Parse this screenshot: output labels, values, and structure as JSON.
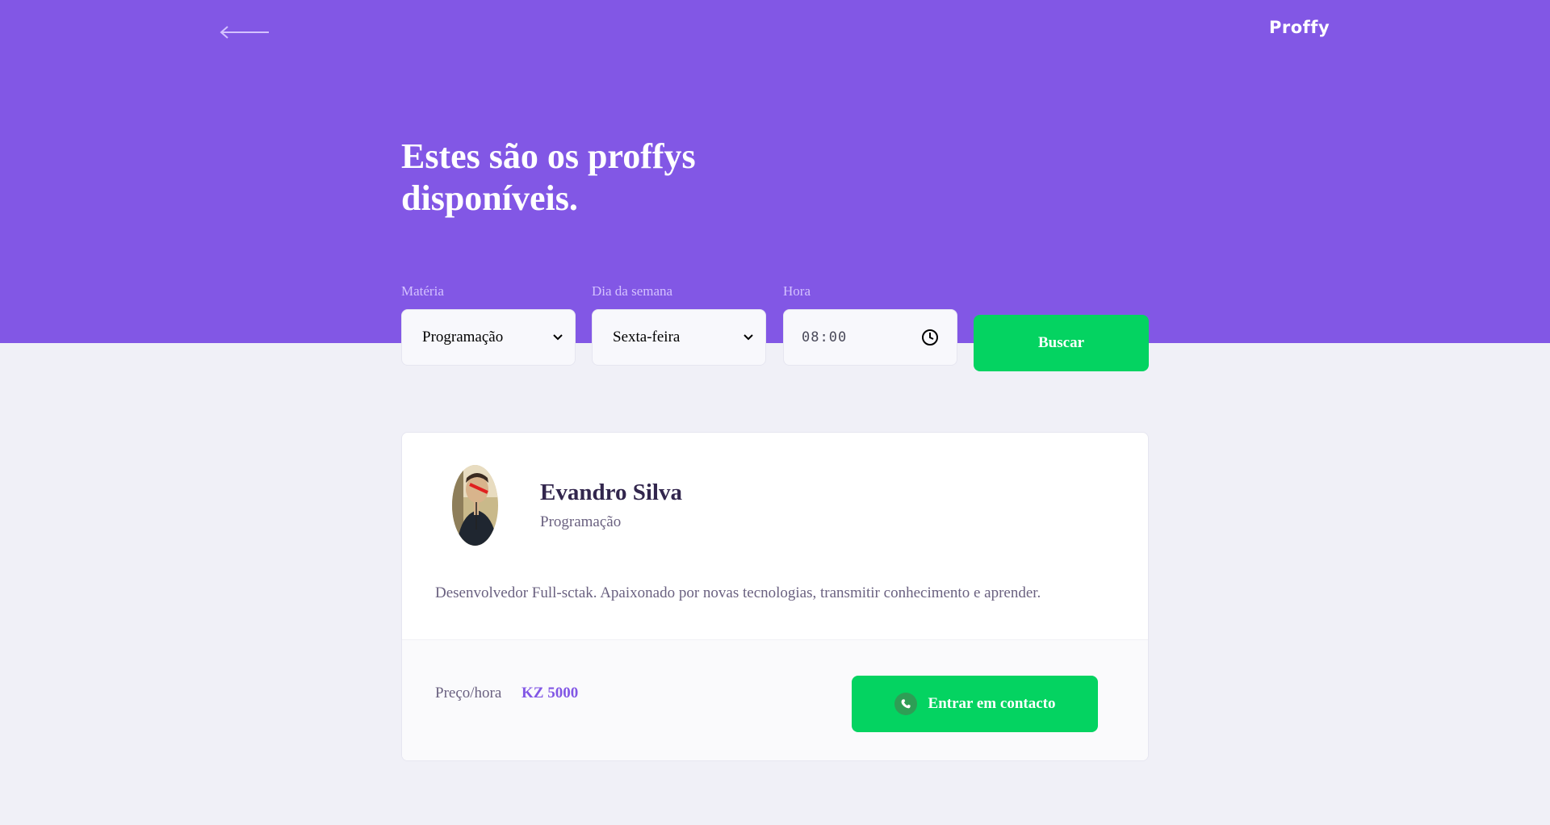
{
  "header": {
    "back_icon": "arrow-left-icon",
    "logo": "Proffy",
    "title": "Estes são os proffys disponíveis.",
    "background_color": "#8257E5"
  },
  "search": {
    "subject": {
      "label": "Matéria",
      "value": "Programação",
      "icon": "chevron-down-icon"
    },
    "weekday": {
      "label": "Dia da semana",
      "value": "Sexta-feira",
      "icon": "chevron-down-icon"
    },
    "time": {
      "label": "Hora",
      "value": "08:00",
      "icon": "clock-icon"
    },
    "button_label": "Buscar",
    "button_color": "#04D361"
  },
  "teacher": {
    "name": "Evandro Silva",
    "subject": "Programação",
    "bio": "Desenvolvedor Full-sctak. Apaixonado por novas tecnologias, transmitir conhecimento e aprender.",
    "price_label": "Preço/hora",
    "price_value": "KZ 5000",
    "contact_label": "Entrar em contacto",
    "contact_icon": "whatsapp-icon"
  },
  "colors": {
    "primary": "#8257E5",
    "secondary": "#04D361",
    "background": "#F0F0F7",
    "title_text": "#32264D",
    "body_text": "#6A6180"
  }
}
